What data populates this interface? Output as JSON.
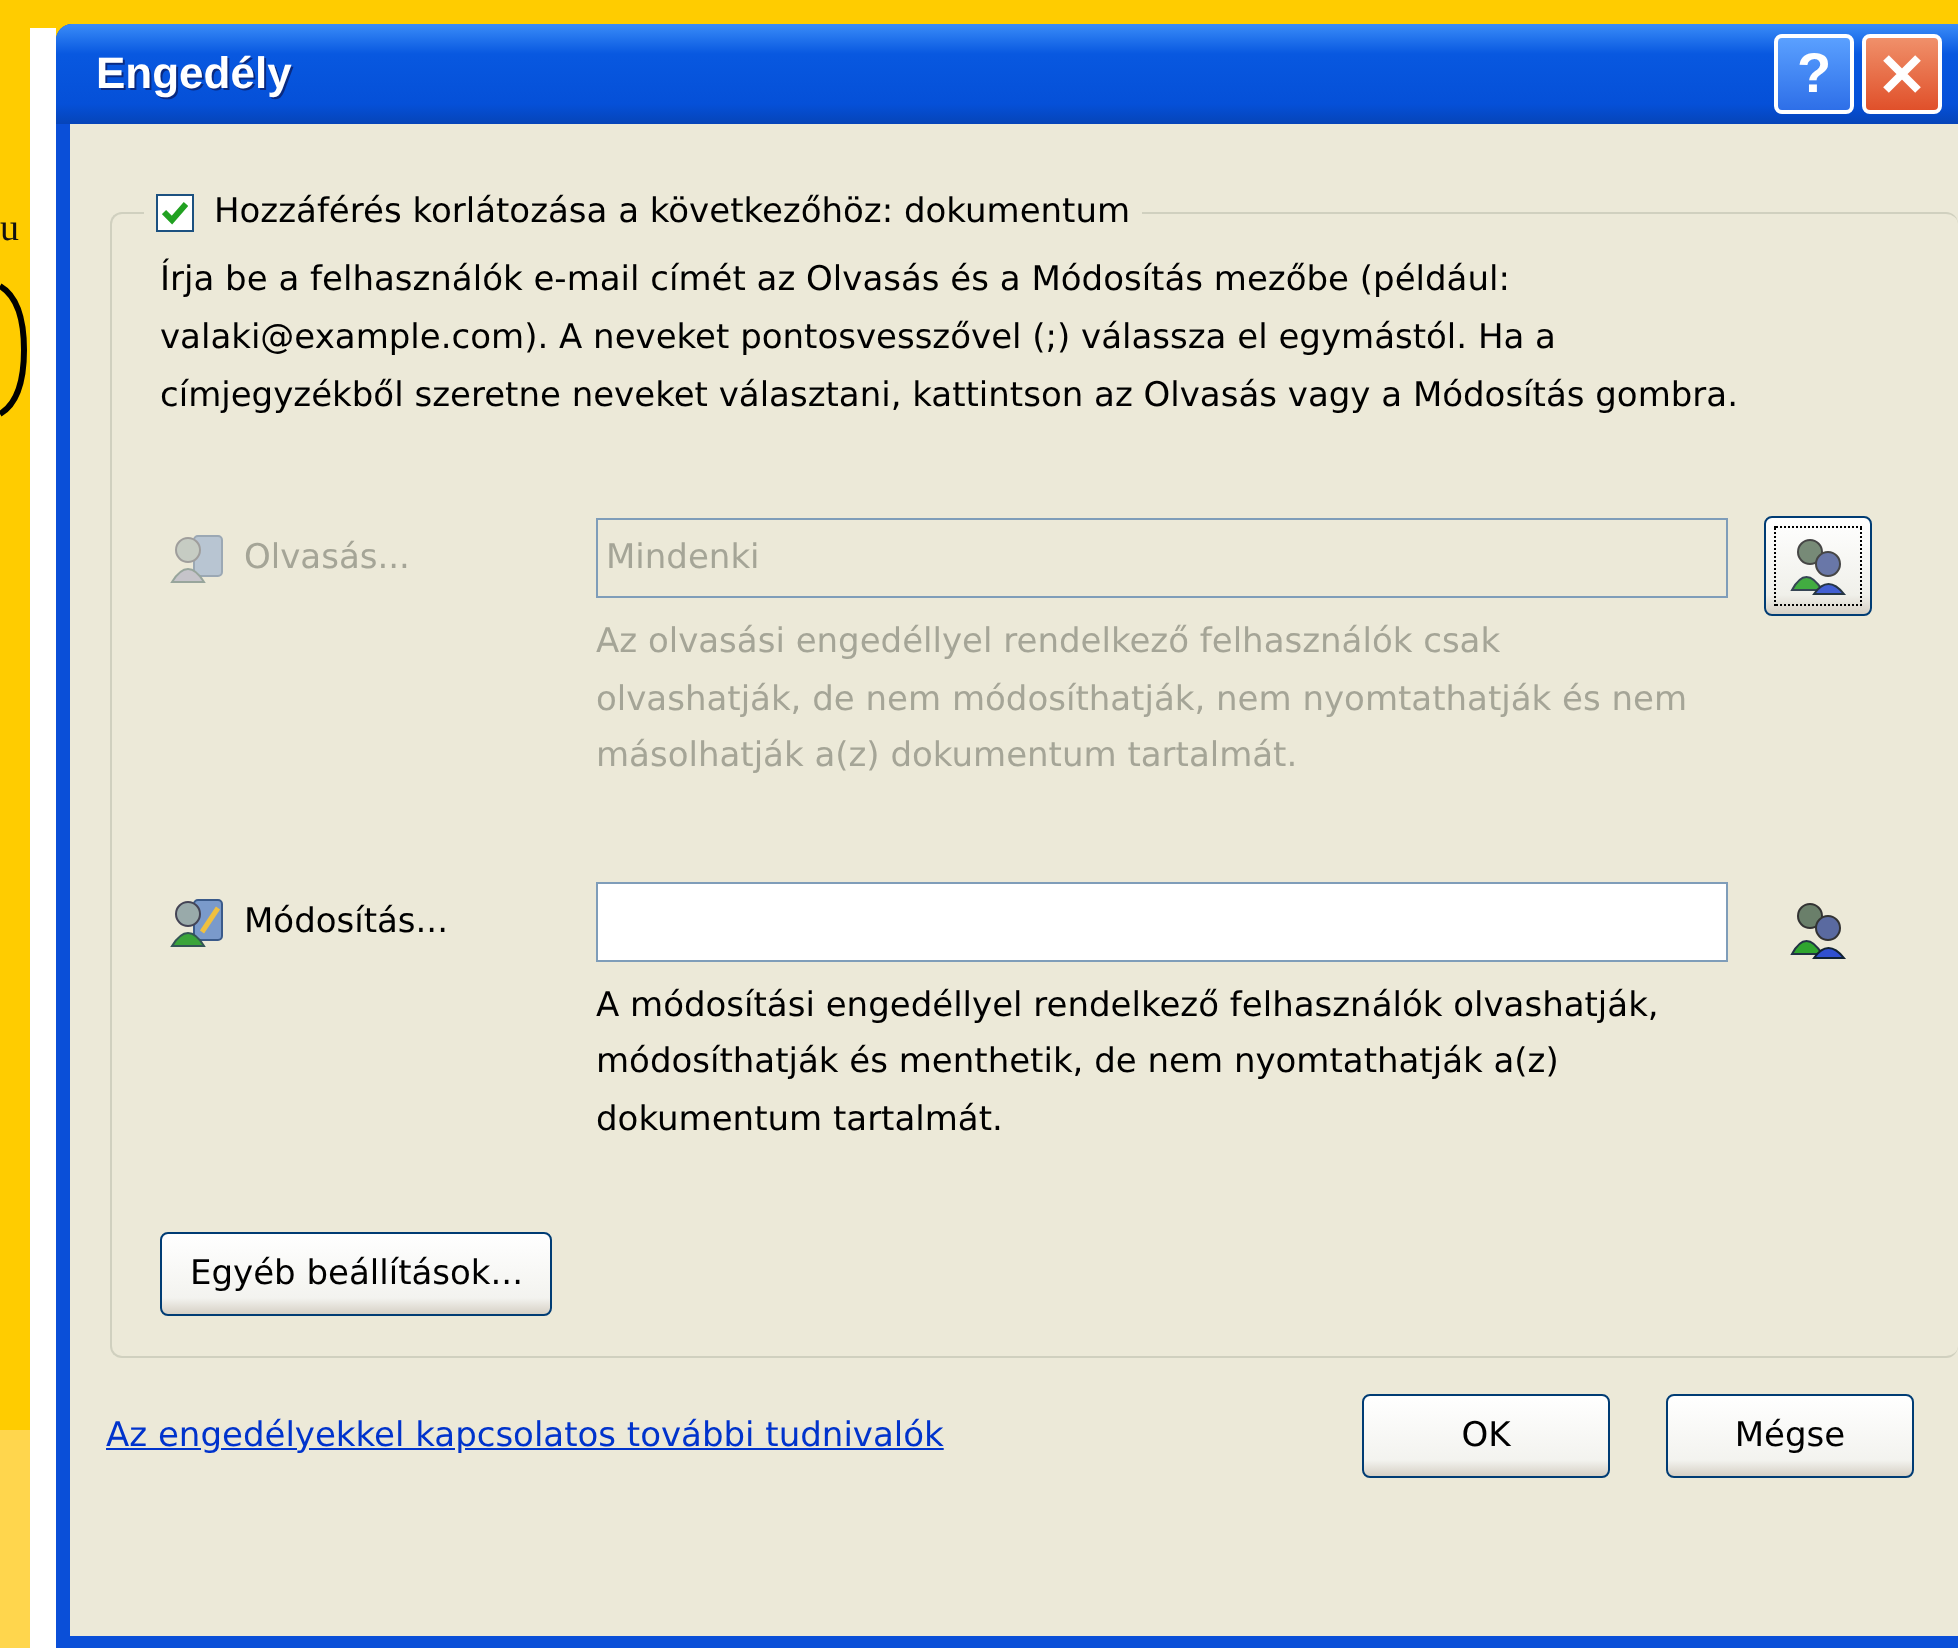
{
  "background": {
    "text": "u"
  },
  "window": {
    "title": "Engedély",
    "help_button": "?"
  },
  "restrict": {
    "label": "Hozzáférés korlátozása a következőhöz: dokumentum",
    "checked": true
  },
  "instructions": "Írja be a felhasználók e-mail címét az Olvasás és a Módosítás mezőbe (például: valaki@example.com). A neveket pontosvesszővel (;) válassza el egymástól. Ha a címjegyzékből szeretne neveket választani, kattintson az Olvasás vagy a Módosítás gombra.",
  "permissions": [
    {
      "kind": "read",
      "label": "Olvasás...",
      "value": "Mindenki",
      "disabled": true,
      "focused": true,
      "description": "Az olvasási engedéllyel rendelkező felhasználók csak olvashatják, de nem módosíthatják, nem nyomtathatják és nem másolhatják a(z) dokumentum tartalmát."
    },
    {
      "kind": "change",
      "label": "Módosítás...",
      "disabled": false,
      "focused": false,
      "description": "A módosítási engedéllyel rendelkező felhasználók olvashatják, módosíthatják és menthetik, de nem nyomtathatják a(z) dokumentum tartalmát."
    }
  ],
  "more_options_button": "Egyéb beállítások...",
  "help_link": "Az engedélyekkel kapcsolatos további tudnivalók",
  "buttons": [
    "OK",
    "Mégse"
  ]
}
